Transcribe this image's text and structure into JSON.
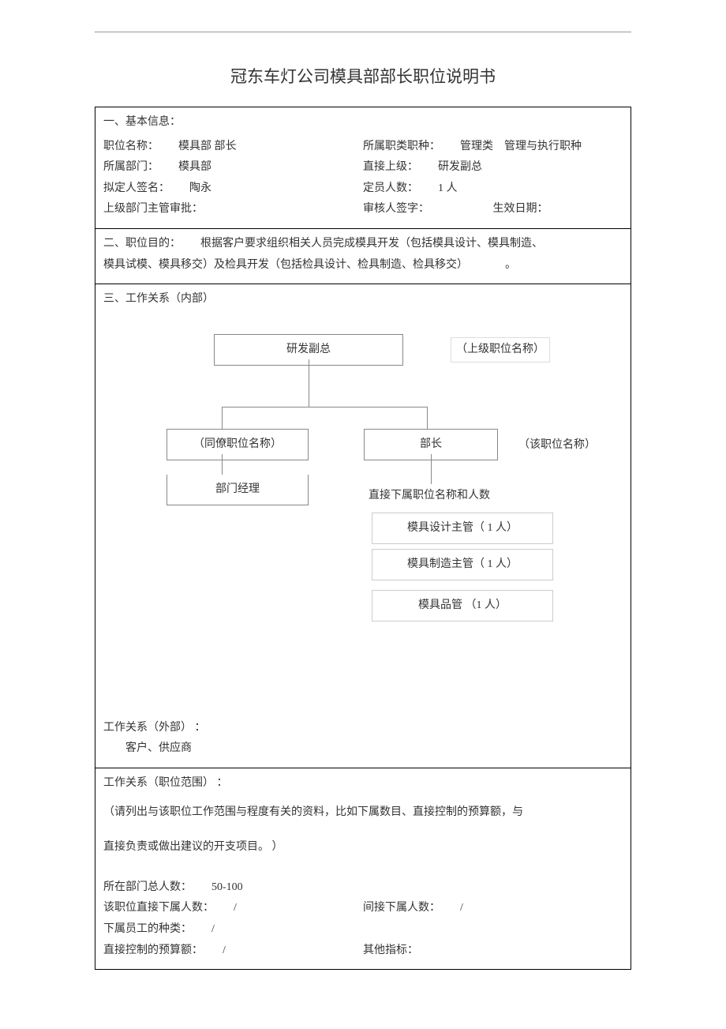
{
  "title": "冠东车灯公司模具部部长职位说明书",
  "section1": {
    "heading": "一、基本信息：",
    "position_label": "职位名称：",
    "position_value": "模具部 部长",
    "jobclass_label": "所属职类职种：",
    "jobclass_value": "管理类　管理与执行职种",
    "dept_label": "所属部门：",
    "dept_value": "模具部",
    "superior_label": "直接上级：",
    "superior_value": "研发副总",
    "signer_label": "拟定人签名：",
    "signer_value": "陶永",
    "headcount_label": "定员人数：",
    "headcount_value": "1 人",
    "approver_label": "上级部门主管审批：",
    "reviewer_label": "审核人签字：",
    "effective_label": "生效日期："
  },
  "section2": {
    "heading": "二、职位目的：",
    "body": "根据客户要求组织相关人员完成模具开发（包括模具设计、模具制造、",
    "body2": "模具试模、模具移交）及检具开发（包括检具设计、检具制造、检具移交）",
    "period": "。"
  },
  "section3": {
    "heading": "三、工作关系（内部）",
    "top_box": "研发副总",
    "top_note": "（上级职位名称）",
    "left_box": "（同僚职位名称）",
    "right_box": "部长",
    "right_note": "（该职位名称）",
    "left_sub": "部门经理",
    "sub_heading": "直接下属职位名称和人数",
    "subs": [
      "模具设计主管（  1 人）",
      "模具制造主管（  1 人）",
      "模具品管        （1 人）"
    ]
  },
  "external": {
    "heading": "工作关系（外部）  ：",
    "body": "客户、供应商"
  },
  "scope": {
    "heading": "工作关系（职位范围）     ：",
    "note1": "（请列出与该职位工作范围与程度有关的资料，比如下属数目、直接控制的预算额，与",
    "note2": "直接负责或做出建议的开支项目。   ）",
    "dept_total_label": "所在部门总人数：",
    "dept_total_value": "50-100",
    "direct_label": "该职位直接下属人数：",
    "direct_value": "/",
    "indirect_label": "间接下属人数：",
    "indirect_value": "/",
    "subtype_label": "下属员工的种类：",
    "subtype_value": "/",
    "budget_label": "直接控制的预算额：",
    "budget_value": "/",
    "other_label": "其他指标："
  }
}
